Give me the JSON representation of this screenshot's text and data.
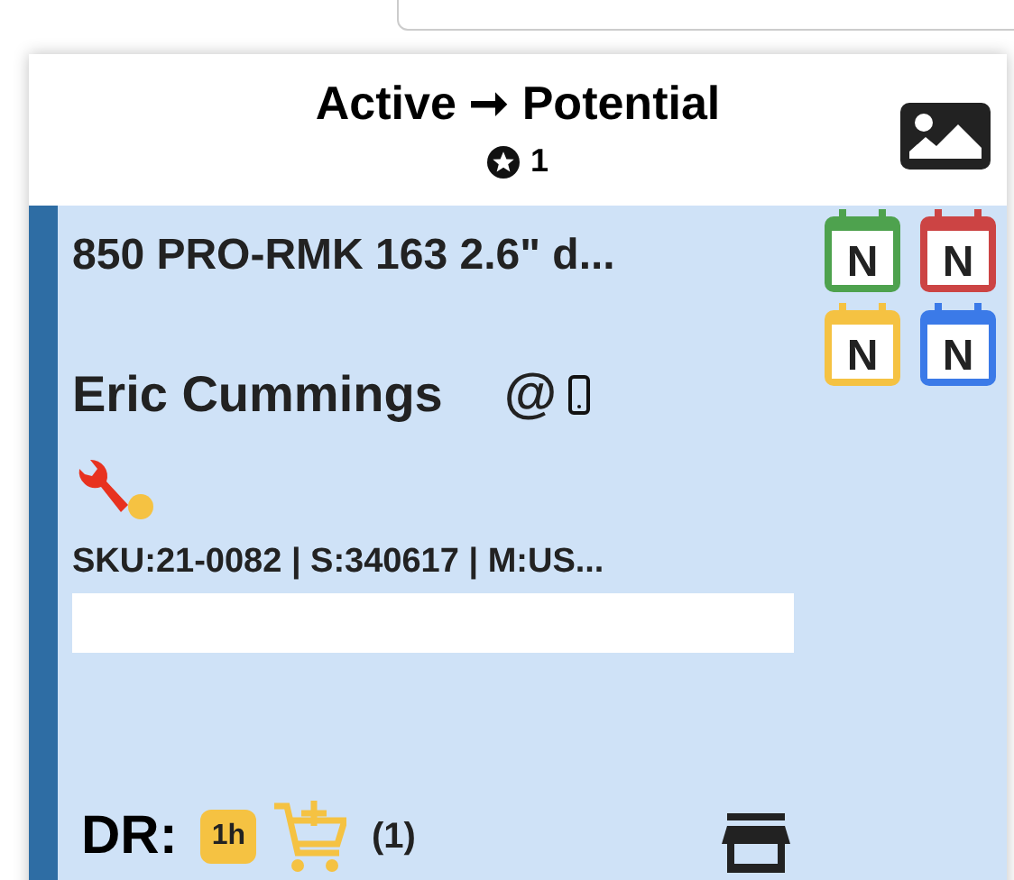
{
  "header": {
    "title": "Active ➞ Potential",
    "count": "1"
  },
  "card": {
    "title": "850 PRO-RMK 163 2.6\" d...",
    "customer": "Eric Cummings",
    "email_symbol": "@",
    "details": "SKU:21-0082 | S:340617 | M:US...",
    "dr_label": "DR:",
    "time_badge": "1h",
    "cart_count": "(1)",
    "calendar_badges": [
      {
        "letter": "N",
        "color": "#4ea24e"
      },
      {
        "letter": "N",
        "color": "#cc4444"
      },
      {
        "letter": "N",
        "color": "#f5c242"
      },
      {
        "letter": "N",
        "color": "#3b7ae8"
      }
    ]
  }
}
